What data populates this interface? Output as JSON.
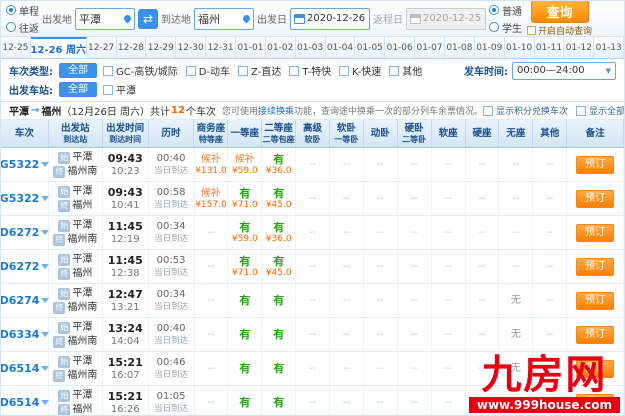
{
  "search": {
    "trip_types": [
      {
        "label": "单程",
        "checked": true
      },
      {
        "label": "往返",
        "checked": false
      }
    ],
    "from": {
      "label": "出发地",
      "value": "平潭"
    },
    "to": {
      "label": "到达地",
      "value": "福州"
    },
    "depart_date": {
      "label": "出发日",
      "value": "2020-12-26"
    },
    "return_date": {
      "label": "返程日",
      "value": "2020-12-25"
    },
    "passenger_types": [
      {
        "label": "普通",
        "checked": true
      },
      {
        "label": "学生",
        "checked": false
      }
    ],
    "query_button": "查询",
    "auto_query_label": "开启自动查询"
  },
  "date_tabs": {
    "selected_index": 1,
    "items": [
      "12-25",
      "12-26 周六",
      "12-27",
      "12-28",
      "12-29",
      "12-30",
      "12-31",
      "01-01",
      "01-02",
      "01-03",
      "01-04",
      "01-05",
      "01-06",
      "01-07",
      "01-08",
      "01-09",
      "01-10",
      "01-11",
      "01-12",
      "01-13"
    ]
  },
  "filters": {
    "train_type": {
      "label": "车次类型:",
      "all": "全部",
      "options": [
        "GC-高铁/城际",
        "D-动车",
        "Z-直达",
        "T-特快",
        "K-快速",
        "其他"
      ]
    },
    "depart_station": {
      "label": "出发车站:",
      "all": "全部",
      "options": [
        "平潭"
      ]
    },
    "depart_time": {
      "label": "发车时间:",
      "value": "00:00—24:00"
    }
  },
  "info_bar": {
    "route_from": "平潭",
    "arrow": "→",
    "route_to": "福州",
    "date_text": "（12月26日 周六）",
    "count_prefix": "共计",
    "count": "12",
    "count_suffix": "个车次",
    "tip_prefix": "您可使用",
    "tip_link": "接续换乘",
    "tip_suffix": "功能，查询途中换乘一次的部分列车余票情况。",
    "toggles": [
      "显示积分兑换车次",
      "显示全部可预订车次"
    ]
  },
  "table": {
    "columns": [
      {
        "l1": "车次",
        "l2": ""
      },
      {
        "l1": "出发站",
        "l2": "到达站"
      },
      {
        "l1": "出发时间",
        "l2": "到达时间"
      },
      {
        "l1": "历时",
        "l2": ""
      },
      {
        "l1": "商务座",
        "l2": "特等座"
      },
      {
        "l1": "一等座",
        "l2": ""
      },
      {
        "l1": "二等座",
        "l2": "二等包座"
      },
      {
        "l1": "高级",
        "l2": "软卧"
      },
      {
        "l1": "软卧",
        "l2": "一等卧"
      },
      {
        "l1": "动卧",
        "l2": ""
      },
      {
        "l1": "硬卧",
        "l2": "二等卧"
      },
      {
        "l1": "软座",
        "l2": ""
      },
      {
        "l1": "硬座",
        "l2": ""
      },
      {
        "l1": "无座",
        "l2": ""
      },
      {
        "l1": "其他",
        "l2": ""
      },
      {
        "l1": "备注",
        "l2": ""
      }
    ],
    "rows": [
      {
        "no": "G5322",
        "from_badge": "始",
        "from": "平潭",
        "to_badge": "终",
        "to": "福州南",
        "depart": "09:43",
        "arrive": "10:23",
        "duration": "00:40",
        "arrive_day": "当日到达",
        "seats": [
          {
            "status": "候补",
            "price": "¥131.0"
          },
          {
            "status": "候补",
            "price": "¥59.0"
          },
          {
            "status": "有",
            "price": "¥36.0"
          },
          "--",
          "--",
          "--",
          "--",
          "--",
          "--",
          "--",
          "--"
        ],
        "action": "预订"
      },
      {
        "no": "G5322",
        "from_badge": "始",
        "from": "平潭",
        "to_badge": "终",
        "to": "福州",
        "depart": "09:43",
        "arrive": "10:41",
        "duration": "00:58",
        "arrive_day": "当日到达",
        "seats": [
          {
            "status": "候补",
            "price": "¥157.0"
          },
          {
            "status": "有",
            "price": "¥71.0"
          },
          {
            "status": "有",
            "price": "¥45.0"
          },
          "--",
          "--",
          "--",
          "--",
          "--",
          "--",
          "--",
          "--"
        ],
        "action": "预订"
      },
      {
        "no": "D6272",
        "from_badge": "始",
        "from": "平潭",
        "to_badge": "终",
        "to": "福州南",
        "depart": "11:45",
        "arrive": "12:19",
        "duration": "00:34",
        "arrive_day": "当日到达",
        "seats": [
          "--",
          {
            "status": "有",
            "price": "¥59.0"
          },
          {
            "status": "有",
            "price": "¥36.0"
          },
          "--",
          "--",
          "--",
          "--",
          "--",
          "--",
          "--",
          "--"
        ],
        "action": "预订"
      },
      {
        "no": "D6272",
        "from_badge": "始",
        "from": "平潭",
        "to_badge": "终",
        "to": "福州",
        "depart": "11:45",
        "arrive": "12:38",
        "duration": "00:53",
        "arrive_day": "当日到达",
        "seats": [
          "--",
          {
            "status": "有",
            "price": "¥71.0"
          },
          {
            "status": "有",
            "price": "¥45.0"
          },
          "--",
          "--",
          "--",
          "--",
          "--",
          "--",
          "--",
          "--"
        ],
        "action": "预订"
      },
      {
        "no": "D6274",
        "from_badge": "始",
        "from": "平潭",
        "to_badge": "终",
        "to": "福州南",
        "depart": "12:47",
        "arrive": "13:21",
        "duration": "00:34",
        "arrive_day": "当日到达",
        "seats": [
          "--",
          {
            "status": "有",
            "price": ""
          },
          {
            "status": "有",
            "price": ""
          },
          "--",
          "--",
          "--",
          "--",
          "--",
          "--",
          {
            "status": "无",
            "price": ""
          },
          "--"
        ],
        "action": "预订"
      },
      {
        "no": "D6334",
        "from_badge": "始",
        "from": "平潭",
        "to_badge": "终",
        "to": "福州南",
        "depart": "13:24",
        "arrive": "14:04",
        "duration": "00:40",
        "arrive_day": "当日到达",
        "seats": [
          "--",
          {
            "status": "有",
            "price": ""
          },
          {
            "status": "有",
            "price": ""
          },
          "--",
          "--",
          "--",
          "--",
          "--",
          "--",
          {
            "status": "无",
            "price": ""
          },
          "--"
        ],
        "action": "预订"
      },
      {
        "no": "D6514",
        "from_badge": "始",
        "from": "平潭",
        "to_badge": "终",
        "to": "福州南",
        "depart": "15:21",
        "arrive": "16:07",
        "duration": "00:46",
        "arrive_day": "当日到达",
        "seats": [
          "--",
          {
            "status": "有",
            "price": ""
          },
          {
            "status": "有",
            "price": ""
          },
          "--",
          "--",
          "--",
          "--",
          "--",
          "--",
          {
            "status": "无",
            "price": ""
          },
          "--"
        ],
        "action": "预订"
      },
      {
        "no": "D6514",
        "from_badge": "始",
        "from": "平潭",
        "to_badge": "终",
        "to": "福州",
        "depart": "15:21",
        "arrive": "16:26",
        "duration": "01:05",
        "arrive_day": "当日到达",
        "seats": [
          "--",
          {
            "status": "有",
            "price": ""
          },
          {
            "status": "有",
            "price": ""
          },
          "--",
          "--",
          "--",
          "--",
          "--",
          "--",
          "--",
          "--"
        ],
        "action": "预订"
      }
    ]
  },
  "watermark": {
    "title": "九房网",
    "url": "www.999house.com"
  }
}
